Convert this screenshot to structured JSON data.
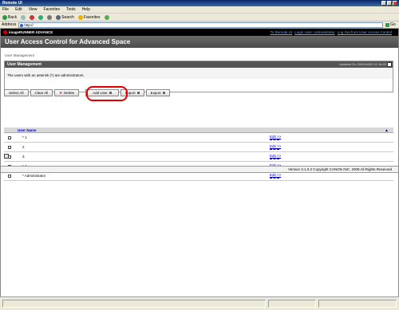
{
  "window": {
    "title": "Remote UI"
  },
  "menu": [
    "File",
    "Edit",
    "View",
    "Favorites",
    "Tools",
    "Help"
  ],
  "toolbar": {
    "back": "Back",
    "search": "Search",
    "favorites": "Favorites"
  },
  "address": {
    "label": "Address",
    "value": "http://",
    "go": "Go"
  },
  "brand": {
    "name": "imageRUNNER ADVANCE"
  },
  "top_links": [
    "To Remote UI",
    "Login User: Administrator",
    "Log Out from User Access Control"
  ],
  "page_title": "User Access Control for Advanced Space",
  "breadcrumb": "User Management",
  "section": {
    "title": "User Management",
    "updated": "Updated On 2009/04/20 11:16:43",
    "note": "The users with an asterisk (*) are administrators."
  },
  "buttons": {
    "select_all": "Select All",
    "clear_all": "Clear All",
    "delete": "Delete",
    "add_user": "Add User",
    "import": "Import",
    "export": "Export"
  },
  "table": {
    "header": "User Name",
    "rows": [
      {
        "name": "* 1",
        "edit": "Edit >>"
      },
      {
        "name": "2",
        "edit": "Edit >>"
      },
      {
        "name": "3",
        "edit": "Edit >>"
      },
      {
        "name": "* 4",
        "edit": "Edit >>"
      },
      {
        "name": "* Administrator",
        "edit": "Edit >>"
      }
    ]
  },
  "footer": "Version 3.1.0.2 Copyright CANON INC. 2009 All Rights Reserved"
}
